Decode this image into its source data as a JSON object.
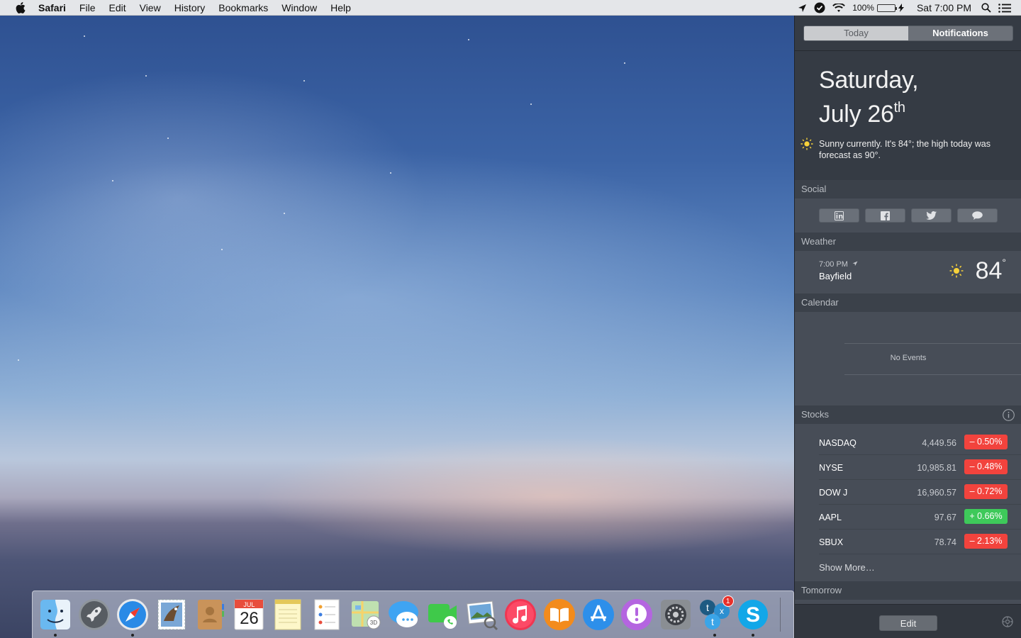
{
  "menubar": {
    "app_name": "Safari",
    "menus": [
      "File",
      "Edit",
      "View",
      "History",
      "Bookmarks",
      "Window",
      "Help"
    ],
    "battery_percent": "100%",
    "battery_level": 1.0,
    "clock": "Sat 7:00 PM",
    "status_icons": [
      "location-arrow-icon",
      "checkmark-shield-icon",
      "wifi-icon",
      "battery-icon",
      "charging-bolt-icon",
      "spotlight-search-icon",
      "notification-center-list-icon"
    ]
  },
  "notification_center": {
    "tabs": [
      {
        "label": "Today",
        "active": false
      },
      {
        "label": "Notifications",
        "active": true
      }
    ],
    "date_line1": "Saturday,",
    "date_line2": "July 26",
    "date_suffix": "th",
    "summary": "Sunny currently. It's 84°; the high today was forecast as 90°.",
    "social": {
      "title": "Social",
      "buttons": [
        "linkedin-icon",
        "facebook-icon",
        "twitter-icon",
        "messages-icon"
      ]
    },
    "weather": {
      "title": "Weather",
      "time": "7:00 PM",
      "city": "Bayfield",
      "temp": "84",
      "degree": "°"
    },
    "calendar": {
      "title": "Calendar",
      "empty_text": "No Events"
    },
    "stocks": {
      "title": "Stocks",
      "rows": [
        {
          "symbol": "NASDAQ",
          "price": "4,449.56",
          "change": "– 0.50%",
          "direction": "down"
        },
        {
          "symbol": "NYSE",
          "price": "10,985.81",
          "change": "– 0.48%",
          "direction": "down"
        },
        {
          "symbol": "DOW J",
          "price": "16,960.57",
          "change": "– 0.72%",
          "direction": "down"
        },
        {
          "symbol": "AAPL",
          "price": "97.67",
          "change": "+ 0.66%",
          "direction": "up"
        },
        {
          "symbol": "SBUX",
          "price": "78.74",
          "change": "– 2.13%",
          "direction": "down"
        }
      ],
      "show_more": "Show More…"
    },
    "tomorrow_title": "Tomorrow",
    "edit_label": "Edit"
  },
  "calendar_icon": {
    "month": "JUL",
    "day": "26"
  },
  "dock": {
    "apps": [
      {
        "name": "finder",
        "running": true
      },
      {
        "name": "launchpad",
        "running": false
      },
      {
        "name": "safari",
        "running": true
      },
      {
        "name": "mail",
        "running": false
      },
      {
        "name": "contacts",
        "running": false
      },
      {
        "name": "calendar",
        "running": false
      },
      {
        "name": "notes",
        "running": false
      },
      {
        "name": "reminders",
        "running": false
      },
      {
        "name": "maps",
        "running": false
      },
      {
        "name": "messages",
        "running": false
      },
      {
        "name": "facetime",
        "running": false
      },
      {
        "name": "preview",
        "running": false
      },
      {
        "name": "itunes",
        "running": false
      },
      {
        "name": "ibooks",
        "running": false
      },
      {
        "name": "app-store",
        "running": false
      },
      {
        "name": "feedback",
        "running": false
      },
      {
        "name": "system-preferences",
        "running": false
      },
      {
        "name": "twitter-client",
        "running": true,
        "badge": "1"
      },
      {
        "name": "skype",
        "running": true
      }
    ]
  },
  "colors": {
    "stock_down": "#f2433d",
    "stock_up": "#3ec95a",
    "battery": "#3ec13e"
  }
}
